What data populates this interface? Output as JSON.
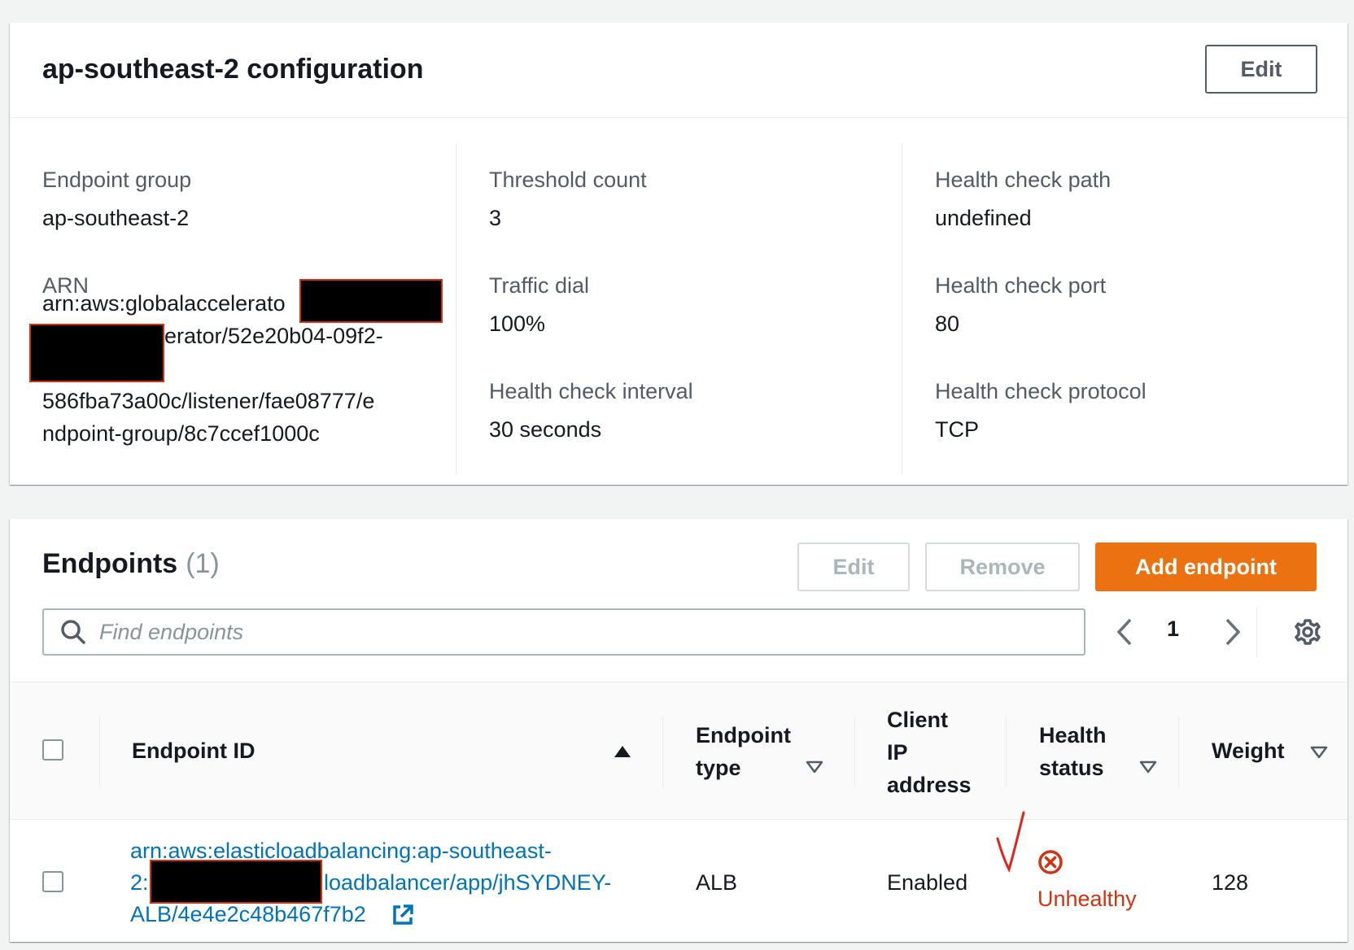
{
  "config": {
    "title": "ap-southeast-2 configuration",
    "edit_label": "Edit",
    "fields": {
      "endpoint_group": {
        "label": "Endpoint group",
        "value": "ap-southeast-2"
      },
      "arn": {
        "label": "ARN",
        "line1": "arn:aws:globalaccelerato",
        "line2": "erator/52e20b04-09f2-",
        "line3": "586fba73a00c/listener/fae08777/e",
        "line4": "ndpoint-group/8c7ccef1000c"
      },
      "threshold_count": {
        "label": "Threshold count",
        "value": "3"
      },
      "traffic_dial": {
        "label": "Traffic dial",
        "value": "100%"
      },
      "health_check_interval": {
        "label": "Health check interval",
        "value": "30 seconds"
      },
      "health_check_path": {
        "label": "Health check path",
        "value": "undefined"
      },
      "health_check_port": {
        "label": "Health check port",
        "value": "80"
      },
      "health_check_protocol": {
        "label": "Health check protocol",
        "value": "TCP"
      }
    }
  },
  "endpoints": {
    "title": "Endpoints",
    "count": "(1)",
    "edit_label": "Edit",
    "remove_label": "Remove",
    "add_label": "Add endpoint",
    "search": {
      "placeholder": "Find endpoints"
    },
    "pagination": {
      "current_page": "1"
    },
    "columns": {
      "endpoint_id": "Endpoint ID",
      "endpoint_type_1": "Endpoint",
      "endpoint_type_2": "type",
      "client_ip_1": "Client",
      "client_ip_2": "IP",
      "client_ip_3": "address",
      "health_status_1": "Health",
      "health_status_2": "status",
      "weight": "Weight"
    },
    "rows": [
      {
        "endpoint_id_line1": "arn:aws:elasticloadbalancing:ap-southeast-",
        "endpoint_id_line2_prefix": "2:",
        "endpoint_id_line2_suffix": "loadbalancer/app/jhSYDNEY-",
        "endpoint_id_line3": "ALB/4e4e2c48b467f7b2",
        "endpoint_type": "ALB",
        "client_ip_address": "Enabled",
        "health_status": "Unhealthy",
        "weight": "128"
      }
    ]
  },
  "colors": {
    "accent_orange": "#ec7211",
    "link_blue": "#0073bb",
    "error_red": "#d13212",
    "annotation_red": "#e0241b"
  },
  "icons": [
    "search-icon",
    "chevron-left-icon",
    "chevron-right-icon",
    "gear-icon",
    "sort-ascending-icon",
    "sort-descending-icon",
    "external-link-icon",
    "status-error-icon",
    "checkmark-annotation-icon"
  ]
}
